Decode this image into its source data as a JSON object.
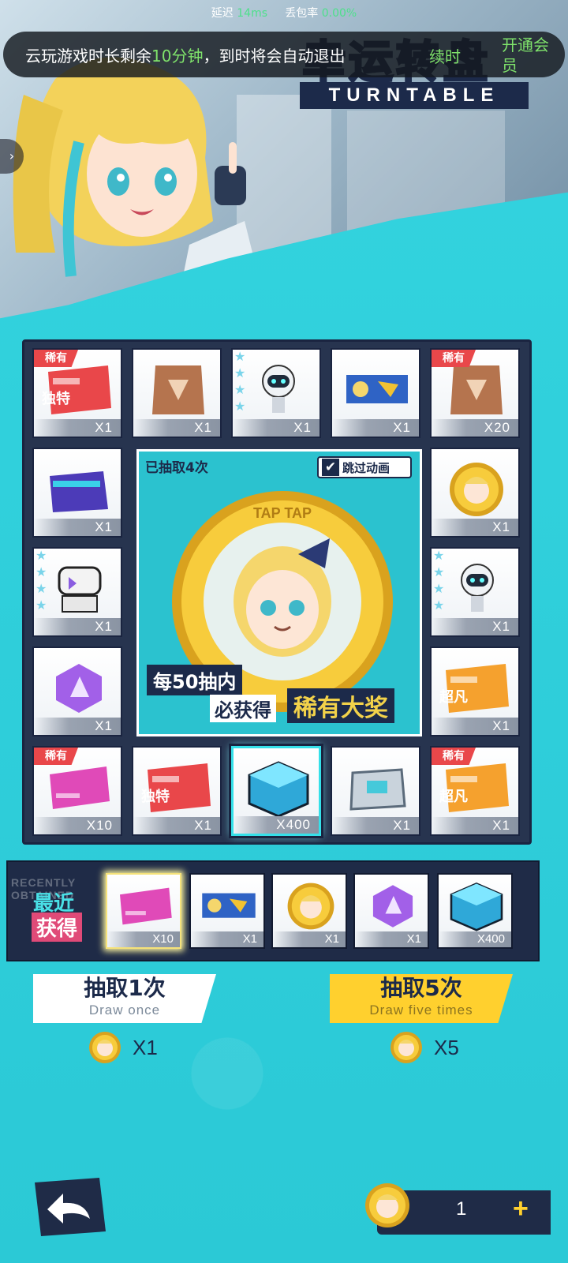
{
  "status_bar": {
    "latency_label": "延迟",
    "latency_value": "14ms",
    "loss_label": "丢包率",
    "loss_value": "0.00%"
  },
  "cloud_banner": {
    "text_before": "云玩游戏时长剩余",
    "minutes": "10分钟",
    "text_after": "，到时将会自动退出",
    "renew_label": "续时",
    "vip_label": "开通会员"
  },
  "logo": {
    "title_cn": "幸运转盘",
    "title_en": "TURNTABLE"
  },
  "board": {
    "draw_count_text": "已抽取4次",
    "skip_animation_label": "跳过动画",
    "skip_animation_checked": true,
    "promo_line1": "每50抽内",
    "promo_line2": "必获得",
    "promo_line3": "稀有大奖",
    "rare_tag": "稀有",
    "coin_text": "TAP TAP",
    "items": [
      {
        "qty": "X1",
        "rare": true,
        "icon": "red-ticket-icon",
        "label": "独特"
      },
      {
        "qty": "X1",
        "rare": false,
        "icon": "bronze-card-icon"
      },
      {
        "qty": "X1",
        "rare": false,
        "icon": "robot-icon",
        "stars": 4
      },
      {
        "qty": "X1",
        "rare": false,
        "icon": "banner-card-icon"
      },
      {
        "qty": "X20",
        "rare": true,
        "icon": "bronze-card-icon"
      },
      {
        "qty": "X1",
        "rare": false,
        "icon": "coin-icon"
      },
      {
        "qty": "X1",
        "rare": false,
        "icon": "robot-icon",
        "stars": 4
      },
      {
        "qty": "X1",
        "rare": false,
        "icon": "orange-ticket-icon",
        "label": "超凡"
      },
      {
        "qty": "X1",
        "rare": true,
        "icon": "orange-ticket-icon",
        "label": "超凡"
      },
      {
        "qty": "X1",
        "rare": false,
        "icon": "metal-chest-icon"
      },
      {
        "qty": "X400",
        "rare": false,
        "icon": "blue-cube-icon",
        "selected": true
      },
      {
        "qty": "X1",
        "rare": false,
        "icon": "red-ticket-icon",
        "label": "独特"
      },
      {
        "qty": "X10",
        "rare": true,
        "icon": "pink-card-icon"
      },
      {
        "qty": "X1",
        "rare": false,
        "icon": "purple-crystal-icon"
      },
      {
        "qty": "X1",
        "rare": false,
        "icon": "mech-suit-icon",
        "stars": 4
      },
      {
        "qty": "X1",
        "rare": false,
        "icon": "folder-card-icon"
      }
    ]
  },
  "recent": {
    "title_line1": "最近",
    "title_line2": "获得",
    "watermark": "RECENTLY OBTAINED",
    "items": [
      {
        "qty": "X10",
        "icon": "pink-card-icon"
      },
      {
        "qty": "X1",
        "icon": "banner-card-icon"
      },
      {
        "qty": "X1",
        "icon": "coin-icon"
      },
      {
        "qty": "X1",
        "icon": "purple-crystal-icon"
      },
      {
        "qty": "X400",
        "icon": "blue-cube-icon"
      }
    ]
  },
  "actions": {
    "draw_once_cn": "抽取1次",
    "draw_once_en": "Draw once",
    "draw_once_cost": "X1",
    "draw_five_cn": "抽取5次",
    "draw_five_en": "Draw five times",
    "draw_five_cost": "X5"
  },
  "currency": {
    "amount": "1",
    "plus": "+"
  },
  "colors": {
    "background": "#2fd1dc",
    "board": "#27344f",
    "rare_tag": "#e9474a",
    "accent_yellow": "#ffd02e"
  }
}
